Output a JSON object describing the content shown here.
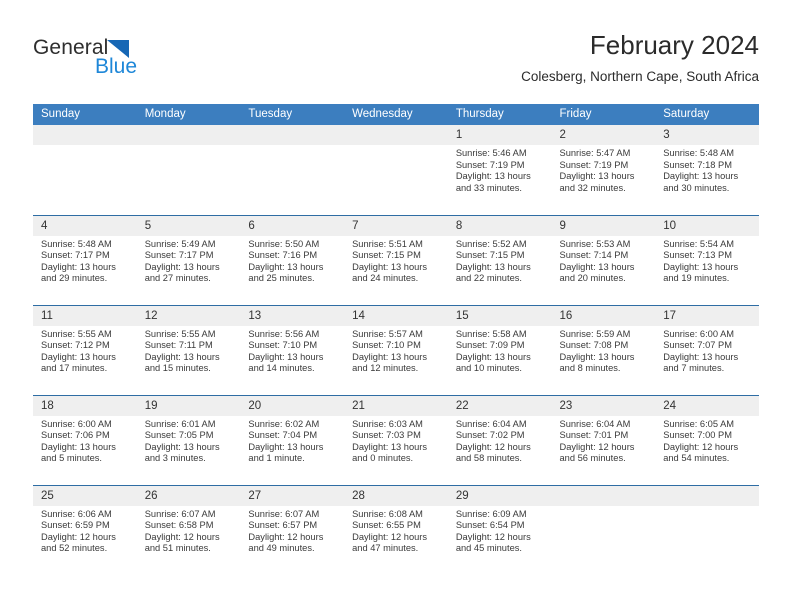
{
  "brand": {
    "word_general": "General",
    "word_blue": "Blue",
    "triangle_color": "#1667b5",
    "blue_color": "#1e87d8"
  },
  "header": {
    "month_title": "February 2024",
    "location": "Colesberg, Northern Cape, South Africa"
  },
  "theme": {
    "header_bg": "#3c7ebf",
    "row_divider": "#2e6da4",
    "daynum_bg": "#efefef",
    "text": "#3a3a3a"
  },
  "calendar": {
    "weekday_headers": [
      "Sunday",
      "Monday",
      "Tuesday",
      "Wednesday",
      "Thursday",
      "Friday",
      "Saturday"
    ],
    "weeks": [
      [
        {
          "day": "",
          "info": ""
        },
        {
          "day": "",
          "info": ""
        },
        {
          "day": "",
          "info": ""
        },
        {
          "day": "",
          "info": ""
        },
        {
          "day": "1",
          "info": "Sunrise: 5:46 AM\nSunset: 7:19 PM\nDaylight: 13 hours\nand 33 minutes."
        },
        {
          "day": "2",
          "info": "Sunrise: 5:47 AM\nSunset: 7:19 PM\nDaylight: 13 hours\nand 32 minutes."
        },
        {
          "day": "3",
          "info": "Sunrise: 5:48 AM\nSunset: 7:18 PM\nDaylight: 13 hours\nand 30 minutes."
        }
      ],
      [
        {
          "day": "4",
          "info": "Sunrise: 5:48 AM\nSunset: 7:17 PM\nDaylight: 13 hours\nand 29 minutes."
        },
        {
          "day": "5",
          "info": "Sunrise: 5:49 AM\nSunset: 7:17 PM\nDaylight: 13 hours\nand 27 minutes."
        },
        {
          "day": "6",
          "info": "Sunrise: 5:50 AM\nSunset: 7:16 PM\nDaylight: 13 hours\nand 25 minutes."
        },
        {
          "day": "7",
          "info": "Sunrise: 5:51 AM\nSunset: 7:15 PM\nDaylight: 13 hours\nand 24 minutes."
        },
        {
          "day": "8",
          "info": "Sunrise: 5:52 AM\nSunset: 7:15 PM\nDaylight: 13 hours\nand 22 minutes."
        },
        {
          "day": "9",
          "info": "Sunrise: 5:53 AM\nSunset: 7:14 PM\nDaylight: 13 hours\nand 20 minutes."
        },
        {
          "day": "10",
          "info": "Sunrise: 5:54 AM\nSunset: 7:13 PM\nDaylight: 13 hours\nand 19 minutes."
        }
      ],
      [
        {
          "day": "11",
          "info": "Sunrise: 5:55 AM\nSunset: 7:12 PM\nDaylight: 13 hours\nand 17 minutes."
        },
        {
          "day": "12",
          "info": "Sunrise: 5:55 AM\nSunset: 7:11 PM\nDaylight: 13 hours\nand 15 minutes."
        },
        {
          "day": "13",
          "info": "Sunrise: 5:56 AM\nSunset: 7:10 PM\nDaylight: 13 hours\nand 14 minutes."
        },
        {
          "day": "14",
          "info": "Sunrise: 5:57 AM\nSunset: 7:10 PM\nDaylight: 13 hours\nand 12 minutes."
        },
        {
          "day": "15",
          "info": "Sunrise: 5:58 AM\nSunset: 7:09 PM\nDaylight: 13 hours\nand 10 minutes."
        },
        {
          "day": "16",
          "info": "Sunrise: 5:59 AM\nSunset: 7:08 PM\nDaylight: 13 hours\nand 8 minutes."
        },
        {
          "day": "17",
          "info": "Sunrise: 6:00 AM\nSunset: 7:07 PM\nDaylight: 13 hours\nand 7 minutes."
        }
      ],
      [
        {
          "day": "18",
          "info": "Sunrise: 6:00 AM\nSunset: 7:06 PM\nDaylight: 13 hours\nand 5 minutes."
        },
        {
          "day": "19",
          "info": "Sunrise: 6:01 AM\nSunset: 7:05 PM\nDaylight: 13 hours\nand 3 minutes."
        },
        {
          "day": "20",
          "info": "Sunrise: 6:02 AM\nSunset: 7:04 PM\nDaylight: 13 hours\nand 1 minute."
        },
        {
          "day": "21",
          "info": "Sunrise: 6:03 AM\nSunset: 7:03 PM\nDaylight: 13 hours\nand 0 minutes."
        },
        {
          "day": "22",
          "info": "Sunrise: 6:04 AM\nSunset: 7:02 PM\nDaylight: 12 hours\nand 58 minutes."
        },
        {
          "day": "23",
          "info": "Sunrise: 6:04 AM\nSunset: 7:01 PM\nDaylight: 12 hours\nand 56 minutes."
        },
        {
          "day": "24",
          "info": "Sunrise: 6:05 AM\nSunset: 7:00 PM\nDaylight: 12 hours\nand 54 minutes."
        }
      ],
      [
        {
          "day": "25",
          "info": "Sunrise: 6:06 AM\nSunset: 6:59 PM\nDaylight: 12 hours\nand 52 minutes."
        },
        {
          "day": "26",
          "info": "Sunrise: 6:07 AM\nSunset: 6:58 PM\nDaylight: 12 hours\nand 51 minutes."
        },
        {
          "day": "27",
          "info": "Sunrise: 6:07 AM\nSunset: 6:57 PM\nDaylight: 12 hours\nand 49 minutes."
        },
        {
          "day": "28",
          "info": "Sunrise: 6:08 AM\nSunset: 6:55 PM\nDaylight: 12 hours\nand 47 minutes."
        },
        {
          "day": "29",
          "info": "Sunrise: 6:09 AM\nSunset: 6:54 PM\nDaylight: 12 hours\nand 45 minutes."
        },
        {
          "day": "",
          "info": ""
        },
        {
          "day": "",
          "info": ""
        }
      ]
    ]
  }
}
